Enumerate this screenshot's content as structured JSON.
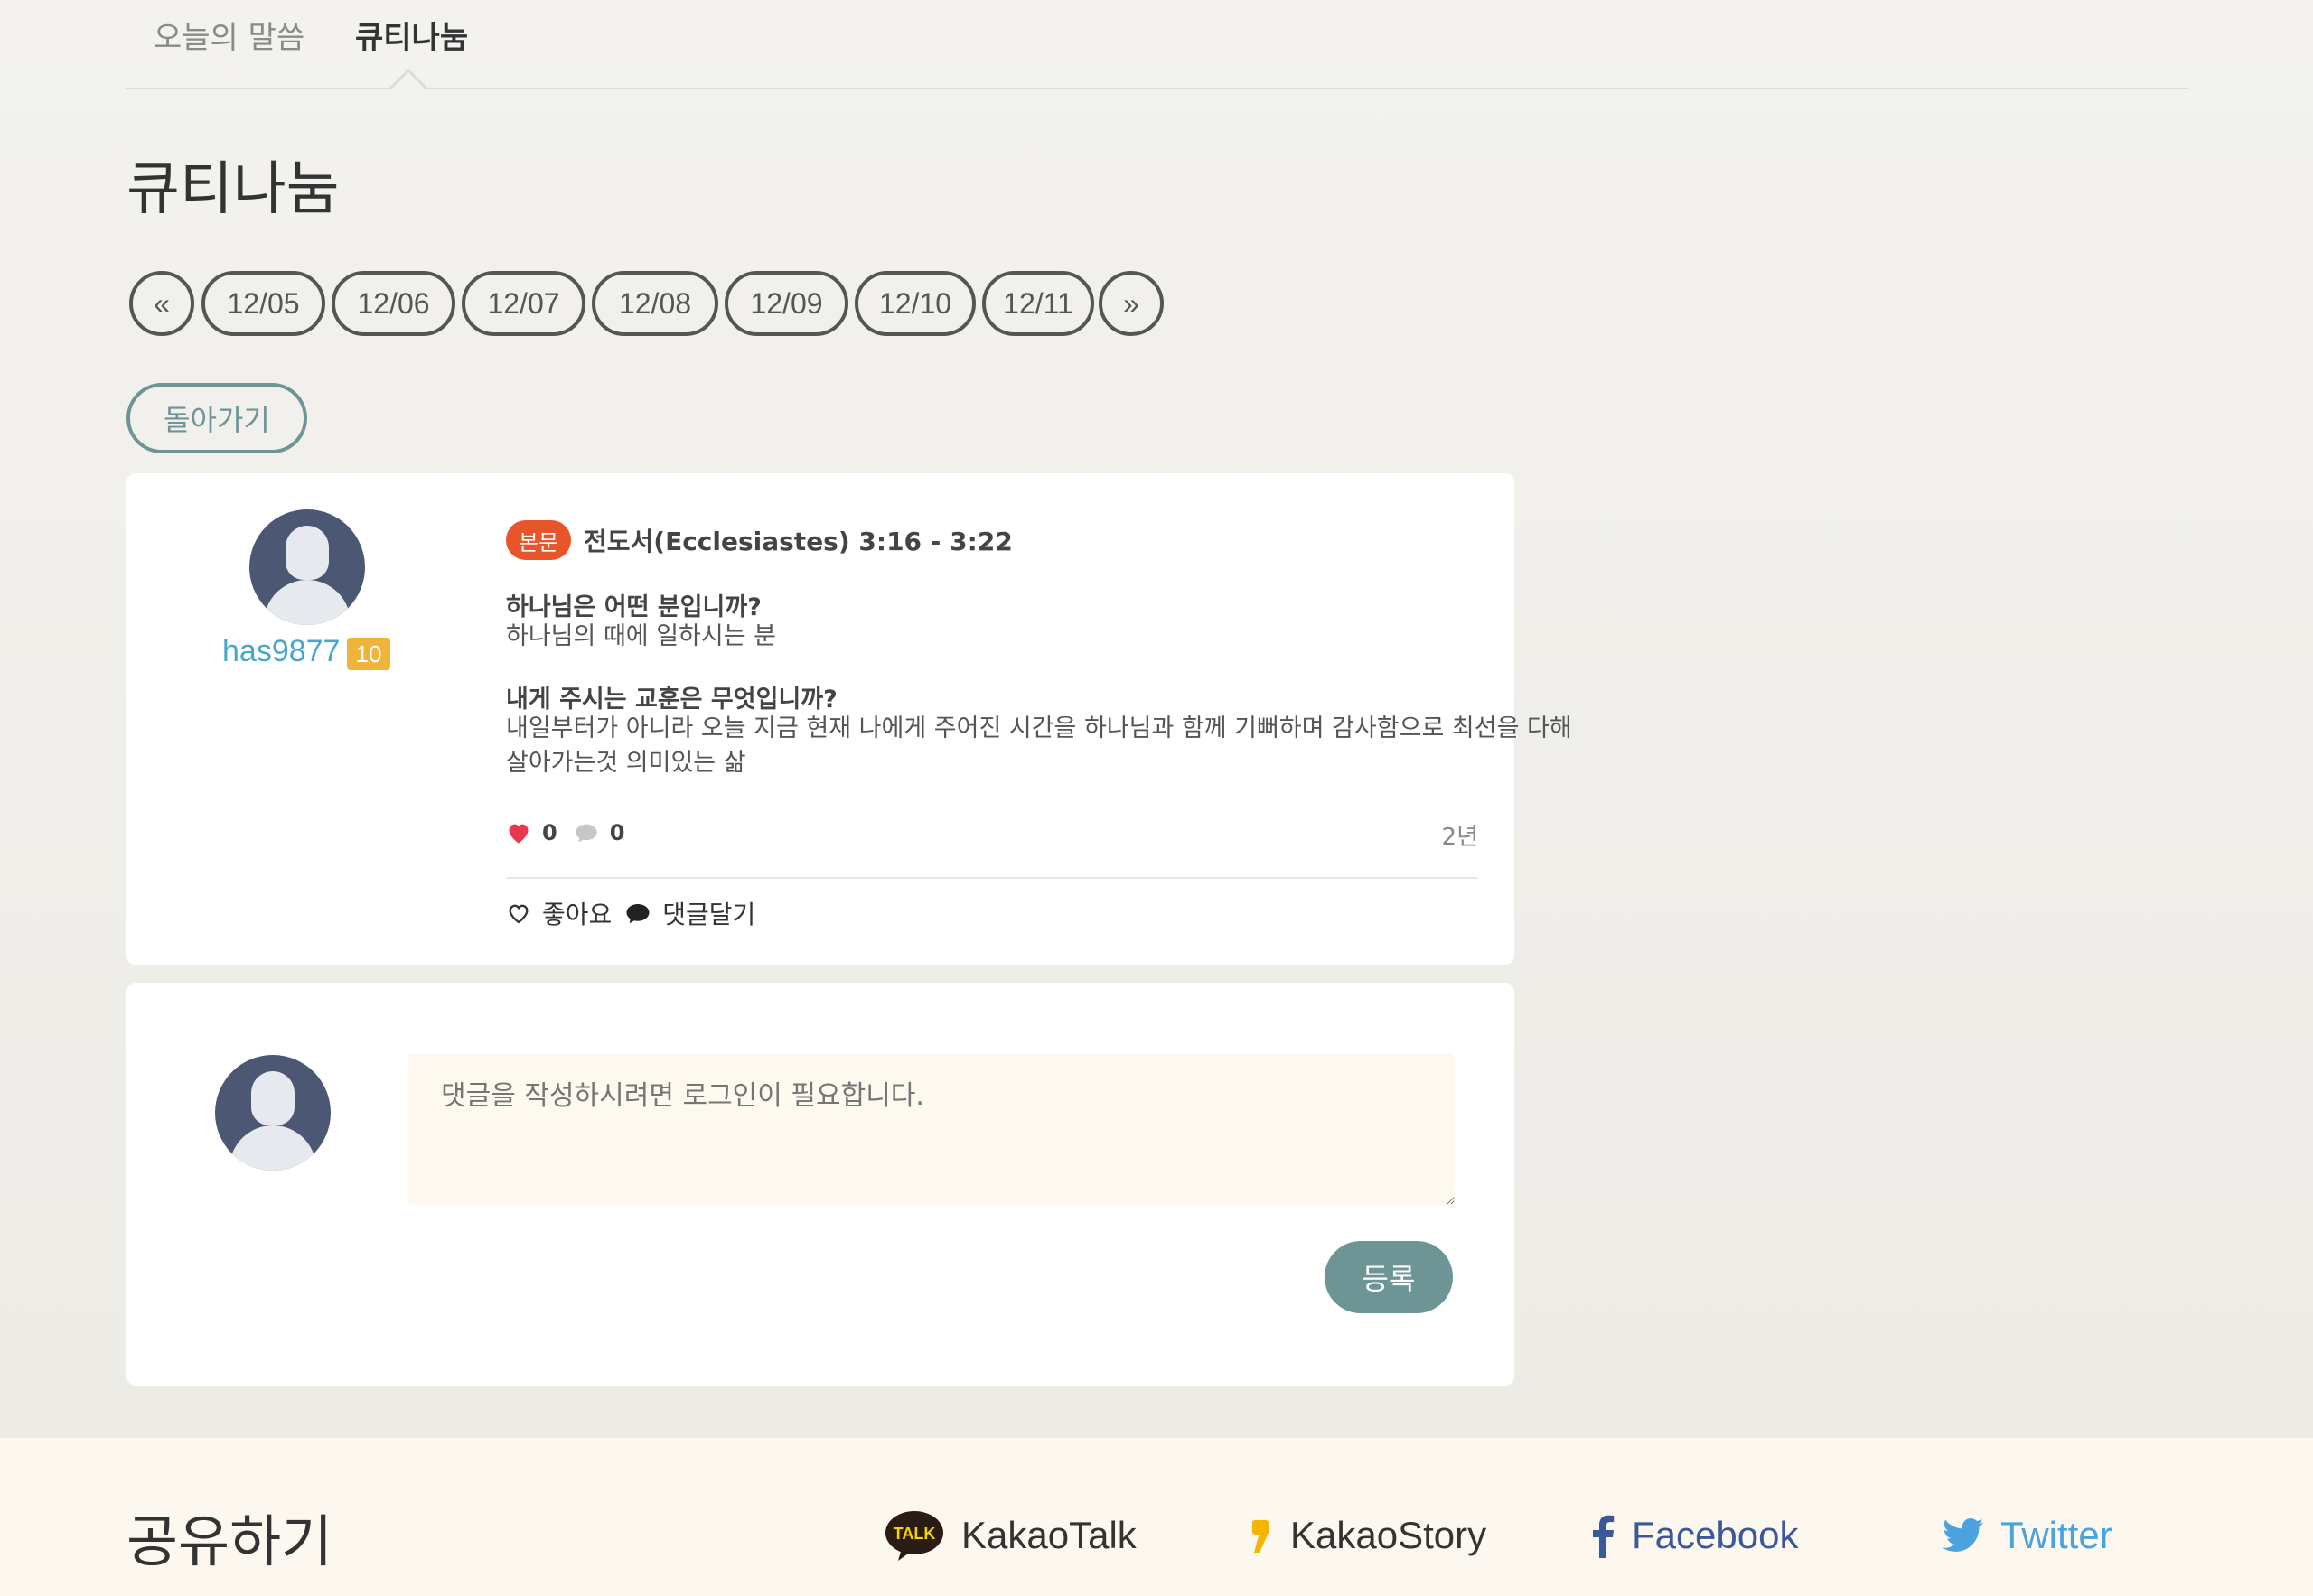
{
  "tabs": [
    {
      "label": "오늘의 말씀",
      "active": false
    },
    {
      "label": "큐티나눔",
      "active": true
    }
  ],
  "page_title": "큐티나눔",
  "pager": {
    "prev": "«",
    "dates": [
      "12/05",
      "12/06",
      "12/07",
      "12/08",
      "12/09",
      "12/10",
      "12/11"
    ],
    "next": "»"
  },
  "back_label": "돌아가기",
  "post": {
    "username": "has9877",
    "level": "10",
    "badge": "본문",
    "reference": "전도서(Ecclesiastes) 3:16 - 3:22",
    "q1": "하나님은 어떤 분입니까?",
    "a1": "하나님의 때에 일하시는 분",
    "q2": "내게 주시는 교훈은 무엇입니까?",
    "a2": "내일부터가 아니라 오늘 지금 현재 나에게 주어진 시간을 하나님과 함께 기뻐하며 감사함으로 최선을 다해 살아가는것 의미있는 삶",
    "likes": "0",
    "comments": "0",
    "time": "2년",
    "like_label": "좋아요",
    "comment_label": "댓글달기"
  },
  "comment_form": {
    "placeholder": "댓글을 작성하시려면 로그인이 필요합니다.",
    "submit_label": "등록"
  },
  "share": {
    "title": "공유하기",
    "items": [
      {
        "label": "KakaoTalk",
        "icon": "kakaotalk-icon"
      },
      {
        "label": "KakaoStory",
        "icon": "kakaostory-icon"
      },
      {
        "label": "Facebook",
        "icon": "facebook-icon"
      },
      {
        "label": "Twitter",
        "icon": "twitter-icon"
      }
    ]
  },
  "colors": {
    "accent": "#6e9595",
    "badge": "#e8552a",
    "level": "#f0b43a",
    "username": "#4aa6c8",
    "heart": "#e8384f",
    "facebook": "#3b5998",
    "twitter": "#4aa3df",
    "kakaostory": "#f5b400"
  }
}
